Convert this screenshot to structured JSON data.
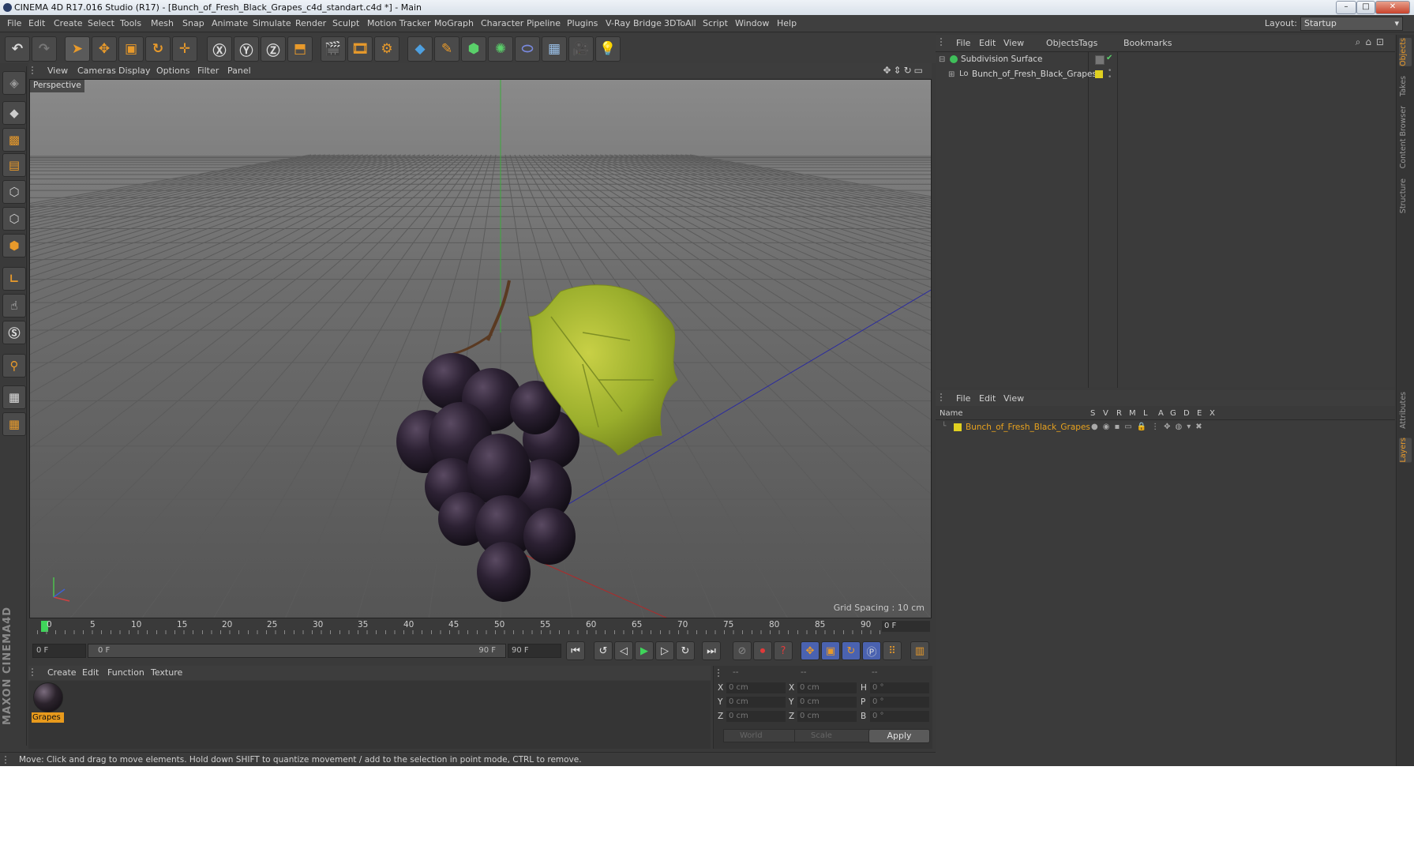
{
  "window": {
    "title": "CINEMA 4D R17.016 Studio (R17) - [Bunch_of_Fresh_Black_Grapes_c4d_standart.c4d *] - Main"
  },
  "menubar": {
    "items": [
      "File",
      "Edit",
      "Create",
      "Select",
      "Tools",
      "Mesh",
      "Snap",
      "Animate",
      "Simulate",
      "Render",
      "Sculpt",
      "Motion Tracker",
      "MoGraph",
      "Character",
      "Pipeline",
      "Plugins",
      "V-Ray Bridge",
      "3DToAll",
      "Script",
      "Window",
      "Help"
    ],
    "layout_label": "Layout:",
    "layout_value": "Startup"
  },
  "viewport": {
    "menu": [
      "View",
      "Cameras",
      "Display",
      "Options",
      "Filter",
      "Panel"
    ],
    "label": "Perspective",
    "grid_spacing": "Grid Spacing : 10 cm"
  },
  "timeline": {
    "ticks": [
      "0",
      "5",
      "10",
      "15",
      "20",
      "25",
      "30",
      "35",
      "40",
      "45",
      "50",
      "55",
      "60",
      "65",
      "70",
      "75",
      "80",
      "85",
      "90"
    ],
    "current_frame": "0 F"
  },
  "transport": {
    "start_field": "0 F",
    "range_start": "0 F",
    "range_end": "90 F",
    "end_field": "90 F"
  },
  "material_manager": {
    "menu": [
      "Create",
      "Edit",
      "Function",
      "Texture"
    ],
    "material_name": "Grapes"
  },
  "coordinates": {
    "headers": [
      "--",
      "--",
      "--"
    ],
    "rows": [
      {
        "a": "X",
        "av": "0 cm",
        "b": "X",
        "bv": "0 cm",
        "c": "H",
        "cv": "0 °"
      },
      {
        "a": "Y",
        "av": "0 cm",
        "b": "Y",
        "bv": "0 cm",
        "c": "P",
        "cv": "0 °"
      },
      {
        "a": "Z",
        "av": "0 cm",
        "b": "Z",
        "bv": "0 cm",
        "c": "B",
        "cv": "0 °"
      }
    ],
    "space_select": "World",
    "scale_select": "Scale",
    "apply_label": "Apply"
  },
  "status": {
    "text": "Move: Click and drag to move elements. Hold down SHIFT to quantize movement / add to the selection in point mode, CTRL to remove."
  },
  "object_manager": {
    "menu": [
      "File",
      "Edit",
      "View",
      "Objects",
      "Tags",
      "Bookmarks"
    ],
    "objects": [
      {
        "name": "Subdivision Surface"
      },
      {
        "name": "Bunch_of_Fresh_Black_Grapes"
      }
    ]
  },
  "layer_manager": {
    "menu": [
      "File",
      "Edit",
      "View"
    ],
    "columns": [
      "Name",
      "S",
      "V",
      "R",
      "M",
      "L",
      "A",
      "G",
      "D",
      "E",
      "X"
    ],
    "layers": [
      {
        "name": "Bunch_of_Fresh_Black_Grapes"
      }
    ]
  },
  "right_tabs": [
    "Objects",
    "Takes",
    "Content Browser",
    "Structure",
    "Attributes",
    "Layers"
  ],
  "brand": "MAXON CINEMA4D",
  "colors": {
    "accent": "#e89a2b",
    "background": "#3a3a3a",
    "layer_text": "#e8a21e",
    "layer_swatch": "#e0d020"
  }
}
